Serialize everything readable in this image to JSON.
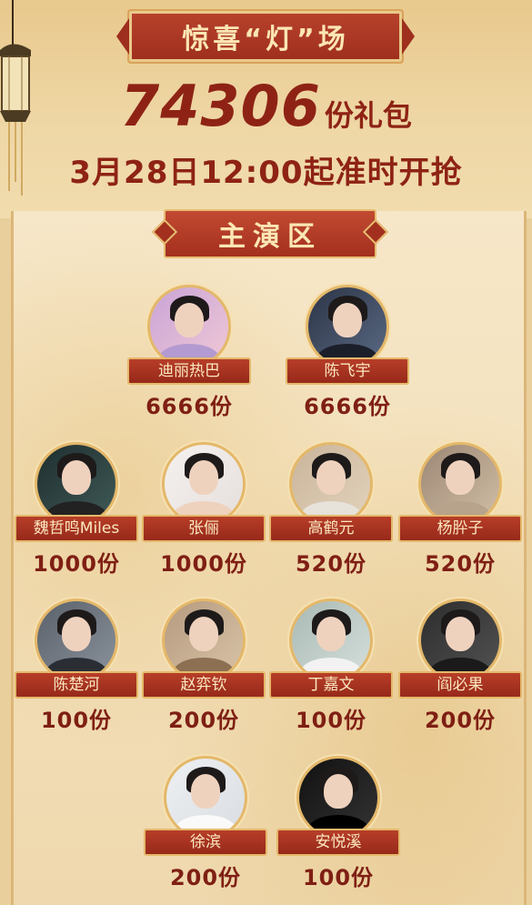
{
  "header": {
    "title": "惊喜“灯”场",
    "total_count": "74306",
    "total_unit": "份礼包",
    "start_time": "3月28日12:00起准时开抢"
  },
  "section": {
    "title": "主演区"
  },
  "stars": [
    {
      "name": "迪丽热巴",
      "count": "6666份"
    },
    {
      "name": "陈飞宇",
      "count": "6666份"
    },
    {
      "name": "魏哲鸣Miles",
      "count": "1000份"
    },
    {
      "name": "张俪",
      "count": "1000份"
    },
    {
      "name": "高鹤元",
      "count": "520份"
    },
    {
      "name": "杨肸子",
      "count": "520份"
    },
    {
      "name": "陈楚河",
      "count": "100份"
    },
    {
      "name": "赵弈钦",
      "count": "200份"
    },
    {
      "name": "丁嘉文",
      "count": "100份"
    },
    {
      "name": "阎必果",
      "count": "200份"
    },
    {
      "name": "徐滨",
      "count": "200份"
    },
    {
      "name": "安悦溪",
      "count": "100份"
    }
  ],
  "colors": {
    "banner_red": "#a3301e",
    "gold_border": "#e4b86a",
    "text_red": "#8e2315",
    "banner_text": "#fbe6b4"
  }
}
